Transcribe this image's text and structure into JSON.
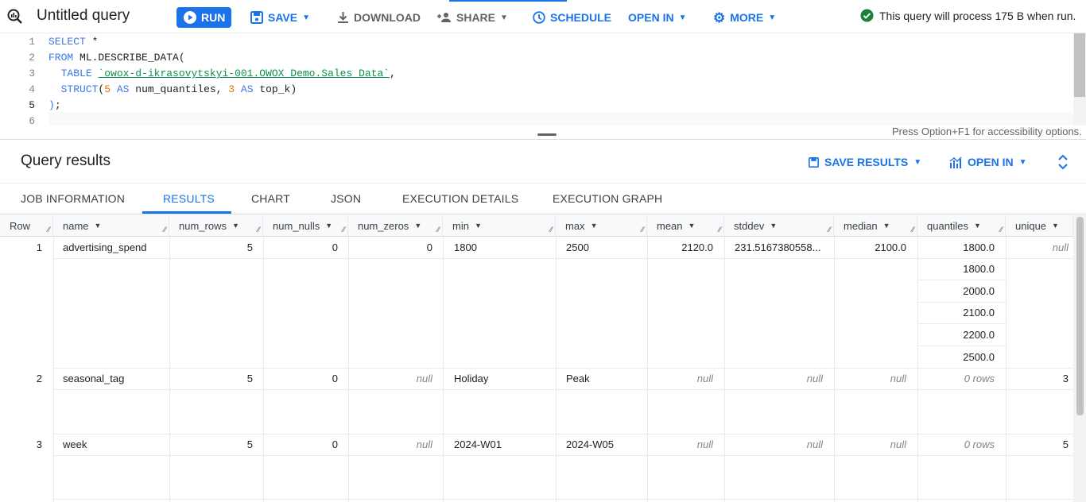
{
  "toolbar": {
    "title": "Untitled query",
    "run_label": "RUN",
    "save_label": "SAVE",
    "download_label": "DOWNLOAD",
    "share_label": "SHARE",
    "schedule_label": "SCHEDULE",
    "open_in_label": "OPEN IN",
    "more_label": "MORE",
    "status_text": "This query will process 175 B when run."
  },
  "editor": {
    "line_numbers": [
      "1",
      "2",
      "3",
      "4",
      "5",
      "6"
    ],
    "accessibility_hint": "Press Option+F1 for accessibility options."
  },
  "results": {
    "title": "Query results",
    "save_results_label": "SAVE RESULTS",
    "open_in_label": "OPEN IN",
    "tabs": [
      "JOB INFORMATION",
      "RESULTS",
      "CHART",
      "JSON",
      "EXECUTION DETAILS",
      "EXECUTION GRAPH"
    ],
    "row_header": "Row",
    "columns": [
      "name",
      "num_rows",
      "num_nulls",
      "num_zeros",
      "min",
      "max",
      "mean",
      "stddev",
      "median",
      "quantiles",
      "unique"
    ],
    "null_text": "null",
    "rows": [
      {
        "row": "1",
        "name": "advertising_spend",
        "num_rows": "5",
        "num_nulls": "0",
        "num_zeros": "0",
        "min": "1800",
        "max": "2500",
        "mean": "2120.0",
        "stddev": "231.5167380558...",
        "median": "2100.0",
        "quantiles": [
          "1800.0",
          "1800.0",
          "2000.0",
          "2100.0",
          "2200.0",
          "2500.0"
        ]
      },
      {
        "row": "2",
        "name": "seasonal_tag",
        "num_rows": "5",
        "num_nulls": "0",
        "min": "Holiday",
        "max": "Peak",
        "quantiles_text": "0 rows",
        "unique": "3"
      },
      {
        "row": "3",
        "name": "week",
        "num_rows": "5",
        "num_nulls": "0",
        "min": "2024-W01",
        "max": "2024-W05",
        "quantiles_text": "0 rows",
        "unique": "5"
      }
    ]
  },
  "colors": {
    "accent": "#1a73e8",
    "success": "#188038"
  }
}
